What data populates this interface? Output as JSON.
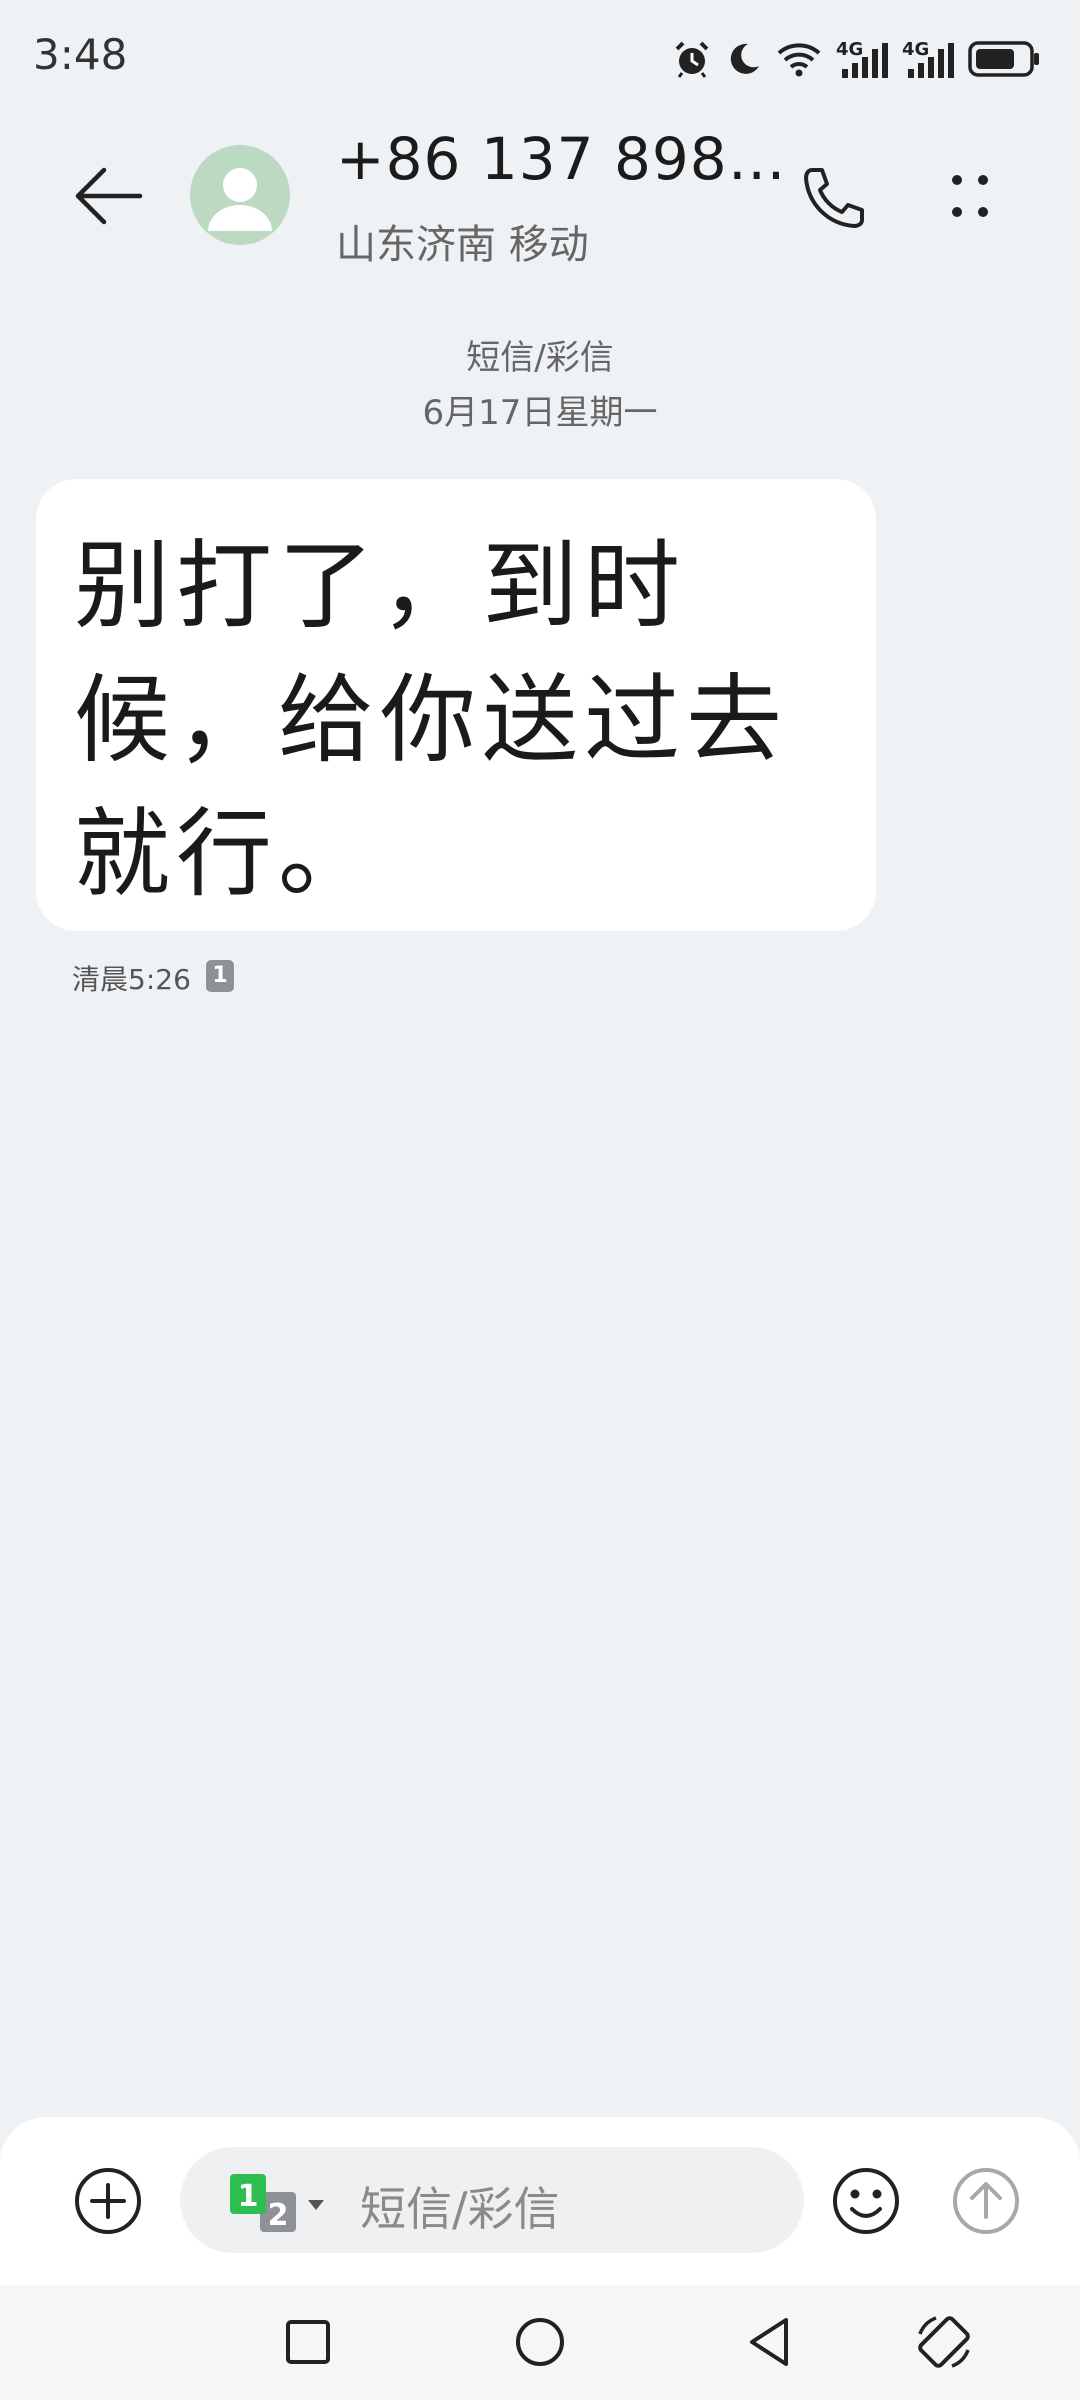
{
  "status_bar": {
    "time": "3:48",
    "icons": [
      "alarm-icon",
      "do-not-disturb-moon-icon",
      "wifi-icon",
      "signal-4g-sim1-icon",
      "signal-4g-sim2-icon",
      "battery-icon"
    ],
    "network_label_1": "4G",
    "network_label_2": "4G",
    "battery_level": 0.75
  },
  "header": {
    "contact": "+86 137 898…",
    "location": "山东济南 移动",
    "avatar_color": "#bcd9c1"
  },
  "conversation": {
    "channel": "短信/彩信",
    "date": "6月17日星期一",
    "messages": [
      {
        "text": "别打了，到时候，给你送过去就行。",
        "time": "清晨5:26",
        "sim": "1"
      }
    ]
  },
  "compose": {
    "sim_primary": "1",
    "sim_secondary": "2",
    "placeholder": "短信/彩信",
    "sim_active_color": "#2fbd4f"
  },
  "nav": {
    "icons": [
      "recent-apps-icon",
      "home-icon",
      "back-icon",
      "rotate-screen-icon"
    ]
  }
}
